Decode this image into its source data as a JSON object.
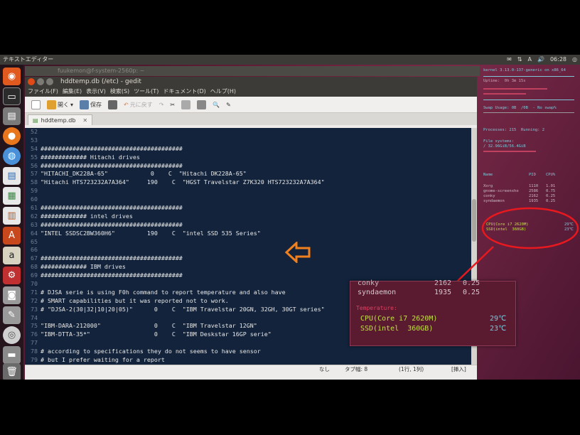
{
  "topbar": {
    "title": "テキストエディター",
    "time": "06:28",
    "indicators": [
      "✉",
      "⇅",
      "A",
      "🔊",
      "◎"
    ]
  },
  "background_window": {
    "title": "fuukemon@f-system-2560p: ~"
  },
  "window": {
    "title": "hddtemp.db (/etc) - gedit",
    "menu": [
      "ファイル(F)",
      "編集(E)",
      "表示(V)",
      "検索(S)",
      "ツール(T)",
      "ドキュメント(D)",
      "ヘルプ(H)"
    ],
    "toolbar": {
      "open": "開く",
      "save": "保存",
      "undo": "元に戻す"
    },
    "tab": "hddtemp.db"
  },
  "editor": {
    "lines": [
      {
        "n": "52",
        "t": ""
      },
      {
        "n": "53",
        "t": ""
      },
      {
        "n": "54",
        "t": "########################################"
      },
      {
        "n": "55",
        "t": "############# Hitachi drives"
      },
      {
        "n": "56",
        "t": "########################################"
      },
      {
        "n": "57",
        "t": "\"HITACHI_DK228A-65\"            0    C  \"Hitachi DK228A-65\""
      },
      {
        "n": "58",
        "t": "\"Hitachi HTS723232A7A364\"     190    C  \"HGST Travelstar Z7K320 HTS723232A7A364\""
      },
      {
        "n": "59",
        "t": ""
      },
      {
        "n": "60",
        "t": ""
      },
      {
        "n": "61",
        "t": "########################################"
      },
      {
        "n": "62",
        "t": "############# intel drives"
      },
      {
        "n": "63",
        "t": "########################################"
      },
      {
        "n": "64",
        "t": "\"INTEL SSDSC2BW360H6\"         190    C  \"intel SSD 535 Series\""
      },
      {
        "n": "65",
        "t": ""
      },
      {
        "n": "66",
        "t": ""
      },
      {
        "n": "67",
        "t": "########################################"
      },
      {
        "n": "68",
        "t": "############# IBM drives"
      },
      {
        "n": "69",
        "t": "########################################"
      },
      {
        "n": "70",
        "t": ""
      },
      {
        "n": "71",
        "t": "# DJSA serie is using F0h command to report temperature and also have"
      },
      {
        "n": "72",
        "t": "# SMART capabilities but it was reported not to work."
      },
      {
        "n": "73",
        "t": "# \"DJSA-2(30|32|10|20|05)\"      0    C  \"IBM Travelstar 20GN, 32GH, 30GT series\""
      },
      {
        "n": "74",
        "t": ""
      },
      {
        "n": "75",
        "t": "\"IBM-DARA-212000\"               0    C  \"IBM Travelstar 12GN\""
      },
      {
        "n": "76",
        "t": "\"IBM-DTTA-35*\"                  0    C  \"IBM Deskstar 16GP serie\""
      },
      {
        "n": "77",
        "t": ""
      },
      {
        "n": "78",
        "t": "# according to specifications they do not seems to have sensor"
      },
      {
        "n": "79",
        "t": "# but I prefer waiting for a report"
      }
    ]
  },
  "statusbar": {
    "lang": "なし",
    "tab": "タブ幅: 8",
    "pos": "(1行, 1列)",
    "mode": "[挿入]"
  },
  "conky": {
    "header": "kernel 3.13.0-137-generic on x86_64",
    "uptime": "Uptime:  0h 3m 15s",
    "processes": "Processes: 215  Running: 2",
    "swap": "Swap Usage: 0B  /0B  - No swap%",
    "filesystem": "File systems:",
    "disk": "/ 32.96GiB/56.4GiB",
    "procs_header": [
      "Name",
      "PID",
      "CPU%"
    ],
    "procs": [
      {
        "name": "Xorg",
        "pid": "1110",
        "cpu": "1.01"
      },
      {
        "name": "gnome-screensho",
        "pid": "2586",
        "cpu": "0.75"
      },
      {
        "name": "conky",
        "pid": "2162",
        "cpu": "0.25"
      },
      {
        "name": "syndaemon",
        "pid": "1935",
        "cpu": "0.25"
      }
    ],
    "temps": [
      {
        "label": "CPU(Core i7 2620M)",
        "value": "29℃"
      },
      {
        "label": "SSD(intel  360GB)",
        "value": "23℃"
      }
    ]
  },
  "zoom": {
    "row1": {
      "name": "conky",
      "pid": "2162",
      "cpu": "0.25"
    },
    "row2": {
      "name": "syndaemon",
      "pid": "1935",
      "cpu": "0.25"
    },
    "section": "Temperature:",
    "temps": [
      {
        "label": "CPU(Core i7 2620M)",
        "value": "29℃"
      },
      {
        "label": "SSD(intel  360GB)",
        "value": "23℃"
      }
    ]
  },
  "colors": {
    "annotation": "#e8191e",
    "arrow": "#f0801e",
    "editor_bg": "#12233b"
  }
}
